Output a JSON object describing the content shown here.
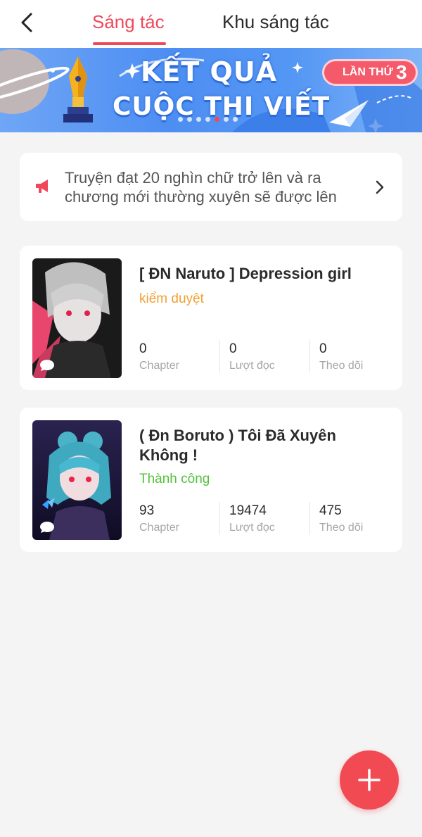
{
  "header": {
    "tabs": [
      {
        "label": "Sáng tác",
        "active": true
      },
      {
        "label": "Khu sáng tác",
        "active": false
      }
    ]
  },
  "banner": {
    "line1": "KẾT QUẢ",
    "line2": "CUỘC THI VIẾT",
    "badge_text": "LẦN THỨ",
    "badge_number": "3",
    "dots_count": 7,
    "active_dot_index": 4
  },
  "notice": {
    "icon": "megaphone-icon",
    "text": "Truyện đạt 20 nghìn chữ trở lên và ra chương mới thường xuyên sẽ được lên"
  },
  "stories": [
    {
      "title": "[ ĐN Naruto ] Depression girl",
      "status": "kiểm duyệt",
      "status_color": "#f0a030",
      "stats": [
        {
          "value": "0",
          "label": "Chapter"
        },
        {
          "value": "0",
          "label": "Lượt đọc"
        },
        {
          "value": "0",
          "label": "Theo dõi"
        }
      ]
    },
    {
      "title": "( Đn Boruto ) Tôi Đã Xuyên Không !",
      "status": "Thành công",
      "status_color": "#52c23a",
      "stats": [
        {
          "value": "93",
          "label": "Chapter"
        },
        {
          "value": "19474",
          "label": "Lượt đọc"
        },
        {
          "value": "475",
          "label": "Theo dõi"
        }
      ]
    }
  ],
  "colors": {
    "accent": "#f0485a",
    "fab": "#f24a52",
    "background": "#f4f4f4"
  },
  "fab": {
    "icon": "plus-icon"
  }
}
